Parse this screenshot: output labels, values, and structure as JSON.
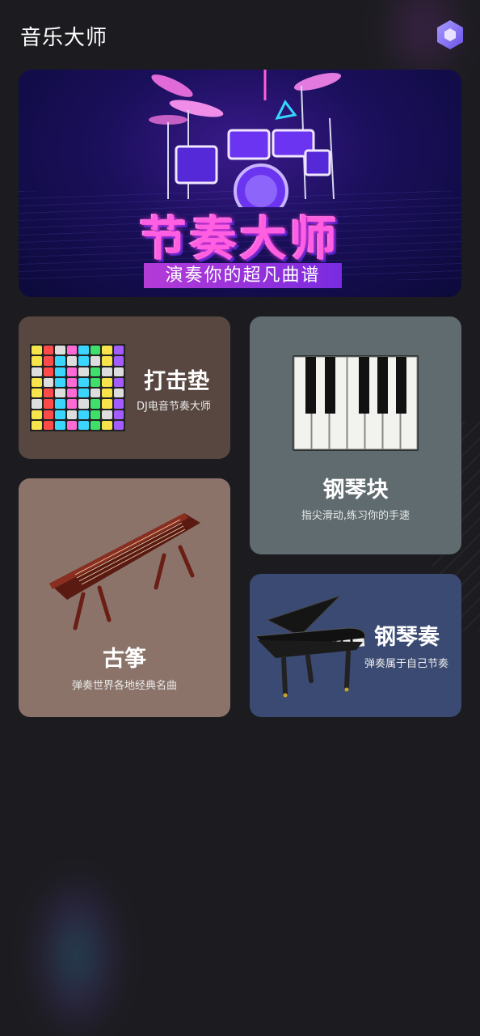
{
  "app": {
    "title": "音乐大师"
  },
  "settings": {
    "icon": "hexagon-settings-icon"
  },
  "banner": {
    "title": "节奏大师",
    "subtitle": "演奏你的超凡曲谱"
  },
  "cards": {
    "drum_pad": {
      "title": "打击垫",
      "subtitle": "DJ电音节奏大师"
    },
    "piano_tiles": {
      "title": "钢琴块",
      "subtitle": "指尖滑动,练习你的手速"
    },
    "guzheng": {
      "title": "古筝",
      "subtitle": "弹奏世界各地经典名曲"
    },
    "piano": {
      "title": "钢琴奏",
      "subtitle": "弹奏属于自己节奏"
    }
  },
  "colors": {
    "background": "#1c1c20",
    "drum_pad_card": "#574740",
    "piano_tiles_card": "#5f6b6e",
    "guzheng_card": "#8b736a",
    "piano_card": "#3a4a72",
    "banner_accent": "#ff5fe0"
  }
}
